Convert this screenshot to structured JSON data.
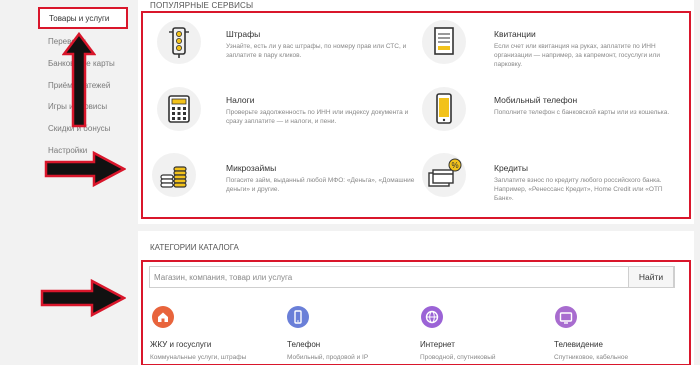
{
  "sidebar": {
    "active_item": "Товары и услуги",
    "items": [
      {
        "label": "Переводы"
      },
      {
        "label": "Банковские карты"
      },
      {
        "label": "Приём платежей"
      },
      {
        "label": "Игры и сервисы"
      },
      {
        "label": "Скидки и бонусы"
      },
      {
        "label": "Настройки"
      }
    ]
  },
  "services": {
    "section_title": "ПОПУЛЯРНЫЕ СЕРВИСЫ",
    "items": [
      {
        "title": "Штрафы",
        "description": "Узнайте, есть ли у вас штрафы, по номеру прав или СТС, и заплатите в пару кликов.",
        "icon": "traffic-light-icon"
      },
      {
        "title": "Квитанции",
        "description": "Если счет или квитанция на руках, заплатите по ИНН организации — например, за капремонт, госуслуги или парковку.",
        "icon": "receipt-icon"
      },
      {
        "title": "Налоги",
        "description": "Проверьте задолженность по ИНН или индексу документа и сразу заплатите — и налоги, и пени.",
        "icon": "calculator-icon"
      },
      {
        "title": "Мобильный телефон",
        "description": "Пополните телефон с банковской карты или из кошелька.",
        "icon": "mobile-phone-icon"
      },
      {
        "title": "Микрозаймы",
        "description": "Погасите займ, выданный любой МФО: «Деньга», «Домашние деньги» и другие.",
        "icon": "coins-icon"
      },
      {
        "title": "Кредиты",
        "description": "Заплатите взнос по кредиту любого российского банка. Например, «Ренессанс Кредит», Home Credit или «ОТП Банк».",
        "icon": "credit-card-percent-icon"
      }
    ]
  },
  "catalog": {
    "section_title": "КАТЕГОРИИ КАТАЛОГА",
    "search": {
      "placeholder": "Магазин, компания, товар или услуга",
      "button_label": "Найти"
    },
    "categories": [
      {
        "label": "ЖКУ и госуслуги",
        "description": "Коммунальные услуги, штрафы",
        "icon": "home-icon",
        "color": "#e8643c"
      },
      {
        "label": "Телефон",
        "description": "Мобильный, продовой и IP",
        "icon": "phone-icon",
        "color": "#6a7fd8"
      },
      {
        "label": "Интернет",
        "description": "Проводной, спутниковый",
        "icon": "globe-icon",
        "color": "#9b63d6"
      },
      {
        "label": "Телевидение",
        "description": "Спутниковое, кабельное",
        "icon": "tv-icon",
        "color": "#a86ccf"
      }
    ]
  },
  "colors": {
    "highlight": "#d9162b",
    "sidebar_bg": "#f2f2f2"
  }
}
